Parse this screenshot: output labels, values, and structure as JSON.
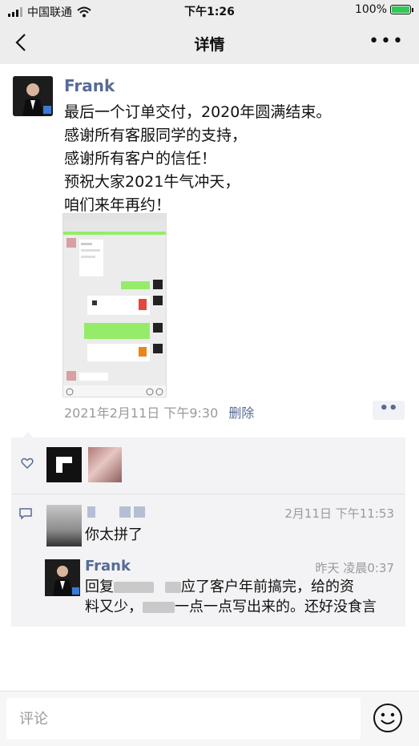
{
  "status_bar": {
    "carrier": "中国联通",
    "time": "下午1:26",
    "battery": "100%"
  },
  "nav": {
    "title": "详情"
  },
  "post": {
    "author": "Frank",
    "lines": [
      "最后一个订单交付，2020年圆满结束。",
      "感谢所有客服同学的支持，",
      "感谢所有客户的信任！",
      "预祝大家2021牛气冲天，",
      "咱们来年再约！"
    ],
    "timestamp": "2021年2月11日 下午9:30",
    "delete_label": "删除"
  },
  "comments": [
    {
      "time": "2月11日 下午11:53",
      "text": "你太拼了"
    }
  ],
  "reply": {
    "author": "Frank",
    "time": "昨天 凌晨0:37",
    "text_prefix": "回复",
    "text_mid": "应了客户年前搞完，给的资",
    "text_line2_a": "料又少，",
    "text_line2_b": "一点一点写出来的。还好没食言"
  },
  "comment_bar": {
    "placeholder": "评论"
  },
  "colors": {
    "link_blue": "#576b95",
    "wechat_green": "#95ec69"
  },
  "icons": [
    "back-icon",
    "more-icon",
    "heart-icon",
    "comment-icon",
    "emoji-icon",
    "wifi-icon",
    "battery-icon",
    "signal-icon"
  ]
}
